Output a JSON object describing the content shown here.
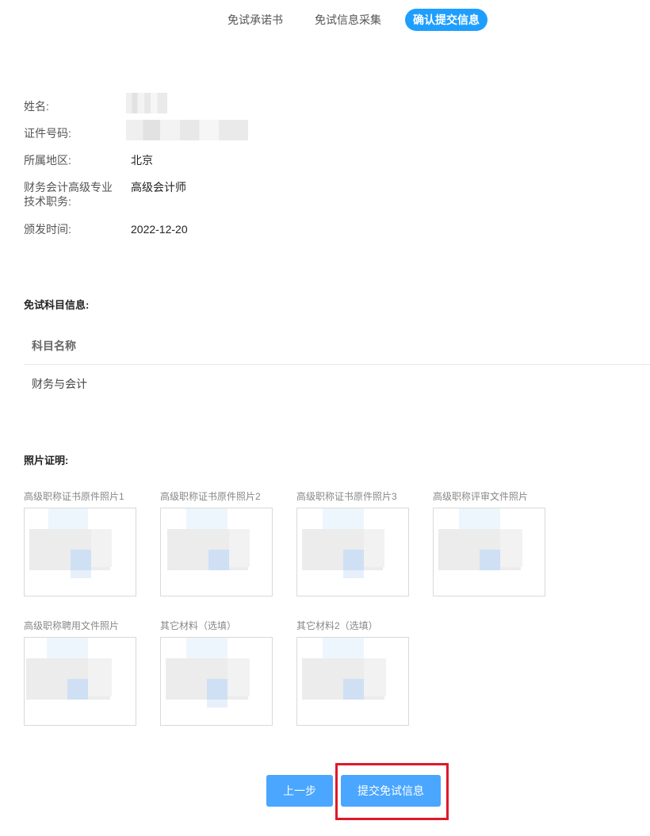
{
  "steps": {
    "items": [
      {
        "label": "免试承诺书"
      },
      {
        "label": "免试信息采集"
      },
      {
        "label": "确认提交信息"
      }
    ],
    "active_color": "#1e9fff"
  },
  "info": {
    "name_label": "姓名:",
    "id_label": "证件号码:",
    "region_label": "所属地区:",
    "region_value": "北京",
    "title_label_line1": "财务会计高级专业",
    "title_label_line2": "技术职务:",
    "title_value": "高级会计师",
    "issue_label": "颁发时间:",
    "issue_value": "2022-12-20"
  },
  "subjects": {
    "section_title": "免试科目信息:",
    "column_header": "科目名称",
    "rows": [
      "财务与会计"
    ]
  },
  "photos": {
    "section_title": "照片证明:",
    "items": [
      {
        "label": "高级职称证书原件照片1"
      },
      {
        "label": "高级职称证书原件照片2"
      },
      {
        "label": "高级职称证书原件照片3"
      },
      {
        "label": "高级职称评审文件照片"
      },
      {
        "label": "高级职称聘用文件照片"
      },
      {
        "label": "其它材料（选填）"
      },
      {
        "label": "其它材料2（选填）"
      }
    ]
  },
  "buttons": {
    "prev_label": "上一步",
    "submit_label": "提交免试信息",
    "color": "#4aa6ff",
    "highlight_color": "#e0182a"
  }
}
